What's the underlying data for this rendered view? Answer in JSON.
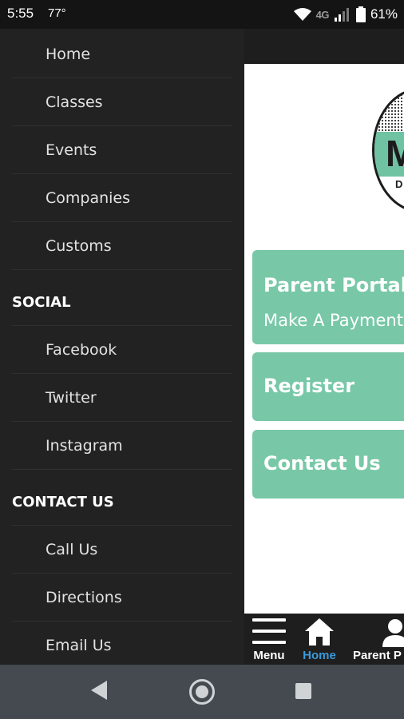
{
  "status_bar": {
    "time": "5:55",
    "temp": "77°",
    "network": "4G",
    "battery": "61%"
  },
  "drawer": {
    "items": [
      {
        "label": "Home"
      },
      {
        "label": "Classes"
      },
      {
        "label": "Events"
      },
      {
        "label": "Companies"
      },
      {
        "label": "Customs"
      }
    ],
    "social": {
      "heading": "SOCIAL",
      "items": [
        {
          "label": "Facebook"
        },
        {
          "label": "Twitter"
        },
        {
          "label": "Instagram"
        }
      ]
    },
    "contact": {
      "heading": "CONTACT US",
      "items": [
        {
          "label": "Call Us"
        },
        {
          "label": "Directions"
        },
        {
          "label": "Email Us"
        }
      ]
    }
  },
  "logo": {
    "letter": "M",
    "small_text": "D"
  },
  "cards": {
    "parent_portal": {
      "title": "Parent Portal",
      "subtitle": "Make A Payment"
    },
    "register": {
      "title": "Register"
    },
    "contact": {
      "title": "Contact Us"
    }
  },
  "tabbar": {
    "menu": "Menu",
    "home": "Home",
    "parent": "Parent P"
  },
  "colors": {
    "accent": "#78c8a7",
    "active_tab": "#3a9ad9",
    "drawer_bg": "#222222"
  }
}
